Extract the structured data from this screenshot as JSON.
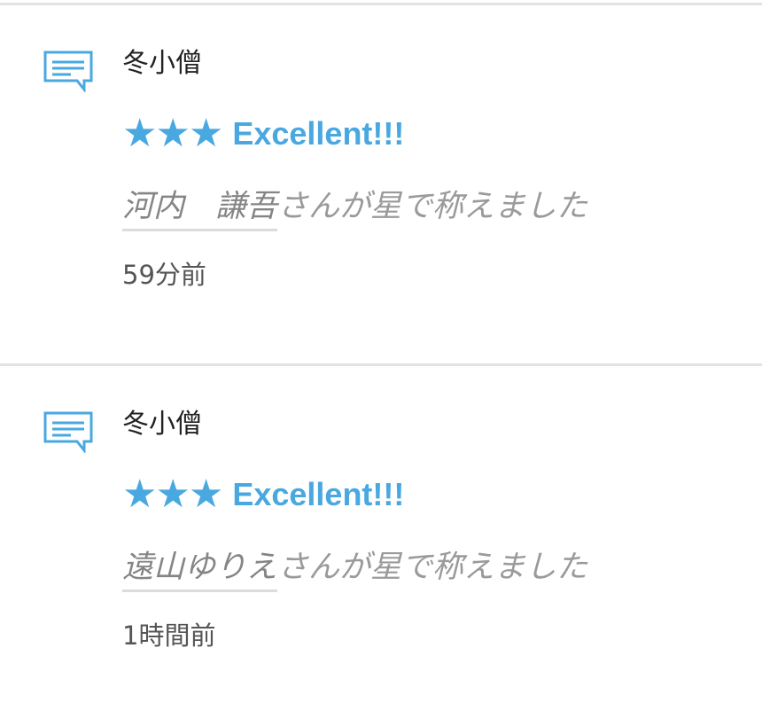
{
  "colors": {
    "accent": "#4aa8e0",
    "divider": "#e2e2e2",
    "praise_text": "#9a9a9a"
  },
  "feed": {
    "items": [
      {
        "icon": "comment-icon",
        "author": "冬小僧",
        "stars": "★★★",
        "rating": 3,
        "rating_label": "Excellent!!!",
        "praiser": "河内　謙吾",
        "praise_suffix": "さんが星で称えました",
        "time": "59分前"
      },
      {
        "icon": "comment-icon",
        "author": "冬小僧",
        "stars": "★★★",
        "rating": 3,
        "rating_label": "Excellent!!!",
        "praiser": "遠山ゆりえ",
        "praise_suffix": "さんが星で称えました",
        "time": "1時間前"
      }
    ]
  }
}
